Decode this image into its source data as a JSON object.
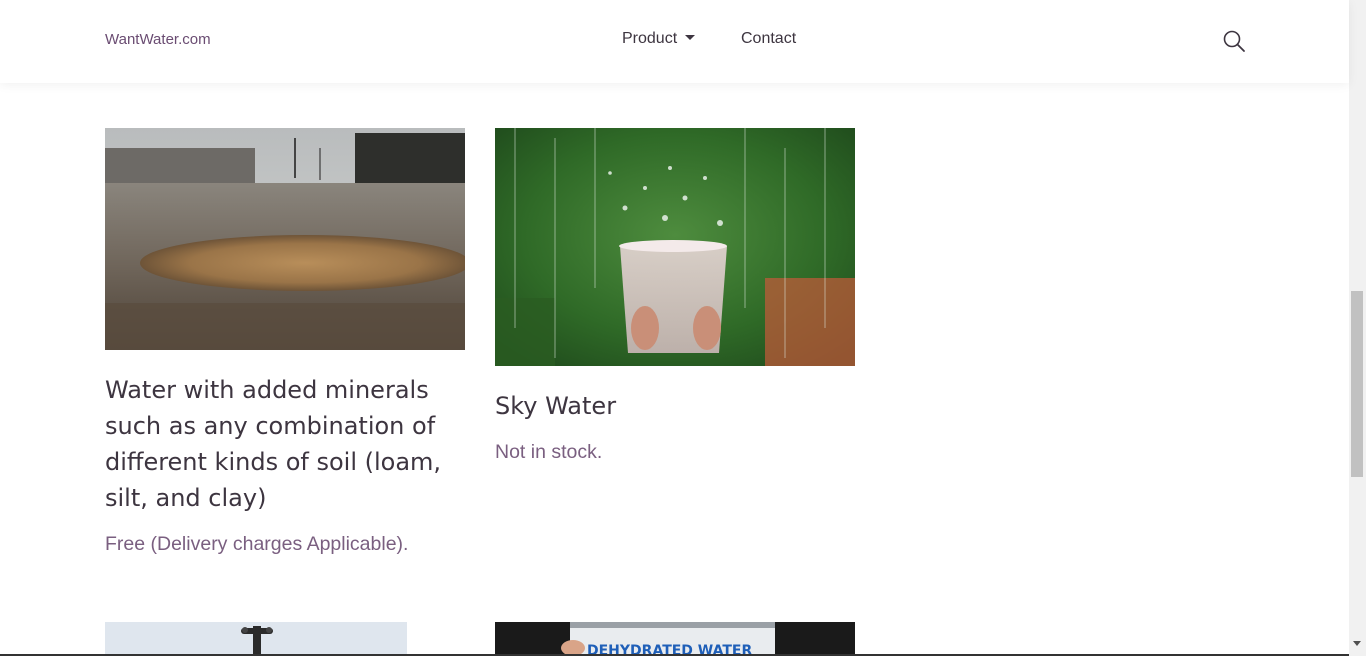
{
  "header": {
    "brand": "WantWater.com",
    "nav": {
      "product_label": "Product",
      "contact_label": "Contact"
    },
    "search_icon": "search-icon"
  },
  "products": [
    {
      "image": "muddy-road-puddle-photo",
      "title": "Water with added minerals such as any combination of different kinds of soil (loam, silt, and clay)",
      "note": "Free (Delivery charges Applicable)."
    },
    {
      "image": "glass-of-rain-water-photo",
      "title": "Sky Water",
      "note": "Not in stock."
    },
    {
      "image": "water-faucet-photo"
    },
    {
      "image": "dehydrated-water-can-photo",
      "can_label": "DEHYDRATED WATER"
    }
  ],
  "colors": {
    "brand_link": "#6a4c72",
    "title_text": "#3d3540",
    "note_text": "#7a5f80"
  }
}
